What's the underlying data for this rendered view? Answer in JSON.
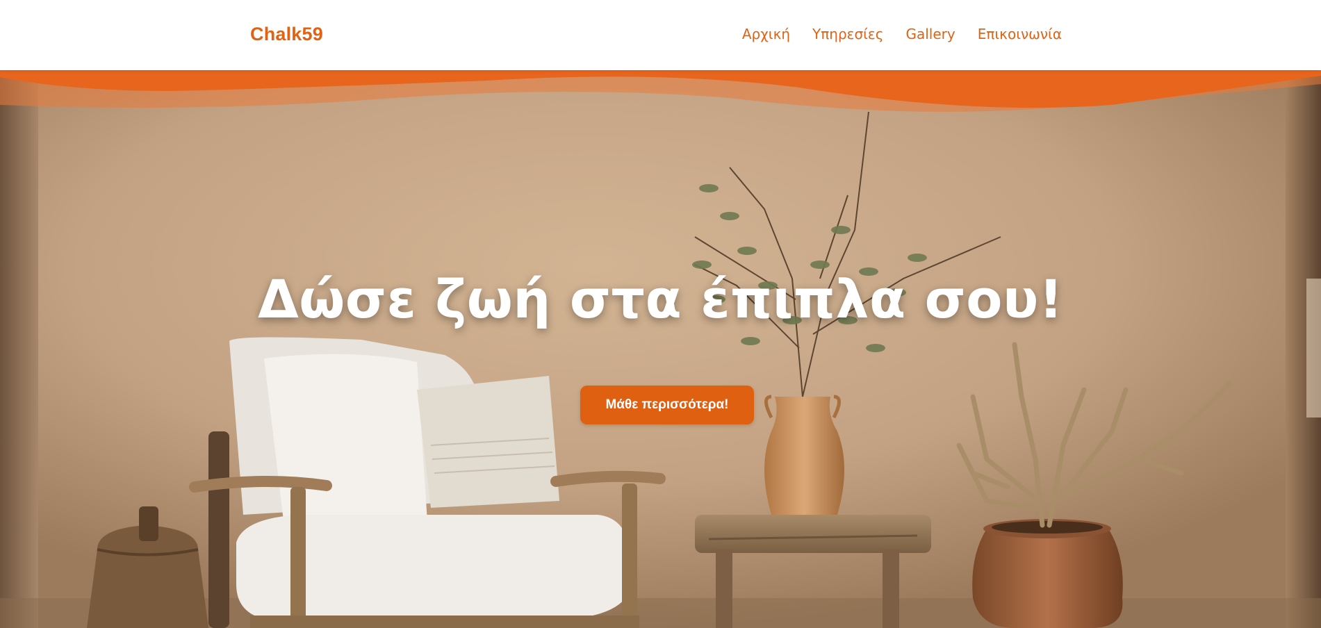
{
  "header": {
    "logo": "Chalk59",
    "nav": [
      {
        "label": "Αρχική"
      },
      {
        "label": "Υπηρεσίες"
      },
      {
        "label": "Gallery"
      },
      {
        "label": "Επικοινωνία"
      }
    ]
  },
  "hero": {
    "title": "Δώσε ζωή στα έπιπλα σου!",
    "cta_label": "Μάθε περισσότερα!"
  },
  "colors": {
    "accent": "#e06315",
    "wave": "#e8651d",
    "background_wall": "#c5a585",
    "text_on_hero": "#ffffff"
  }
}
